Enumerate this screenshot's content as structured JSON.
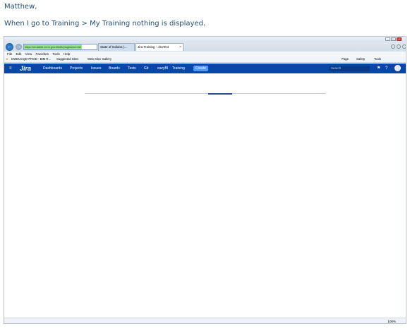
{
  "email": {
    "greeting": "Matthew,",
    "body": "When I go to Training > My Training nothing is displayed."
  },
  "browser": {
    "url": "https://mutable.iot.in.gov:8443/plugins/servlet",
    "tabs": [
      {
        "label": "State of Indiana |..."
      },
      {
        "label": "Jira Training - JiraTest"
      }
    ],
    "menu": [
      "File",
      "Edit",
      "View",
      "Favorites",
      "Tools",
      "Help"
    ],
    "favorites": [
      "DWDUCQD-PROD - BIM R...",
      "Suggested Sites",
      "Web Slice Gallery"
    ],
    "command_bar": [
      "Page",
      "Safety",
      "Tools"
    ],
    "zoom_level": "100%"
  },
  "jira": {
    "logo": "Jira",
    "nav": [
      "Dashboards",
      "Projects",
      "Issues",
      "Boards",
      "Tests",
      "Git",
      "eazyBI",
      "Training"
    ],
    "create_label": "Create",
    "search_placeholder": "Search"
  },
  "loading": {
    "progress_fraction": 0.1
  }
}
